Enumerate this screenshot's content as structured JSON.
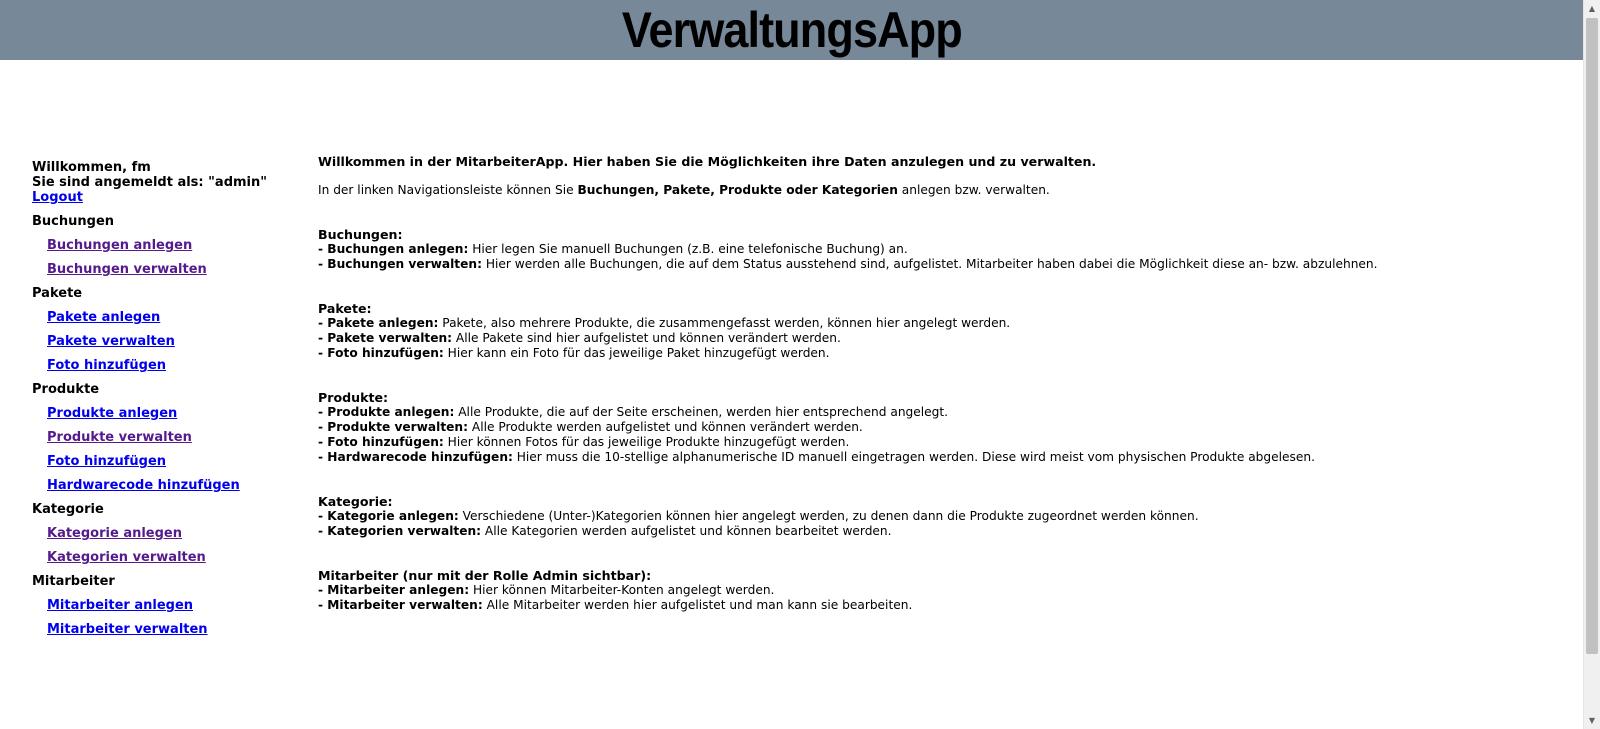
{
  "header": {
    "title": "VerwaltungsApp"
  },
  "user": {
    "welcome": "Willkommen, fm",
    "role_text": "Sie sind angemeldt als: \"admin\"",
    "logout": "Logout"
  },
  "sidebar": {
    "buchungen": {
      "title": "Buchungen",
      "links": [
        "Buchungen anlegen",
        "Buchungen verwalten"
      ]
    },
    "pakete": {
      "title": "Pakete",
      "links": [
        "Pakete anlegen",
        "Pakete verwalten",
        "Foto hinzufügen"
      ]
    },
    "produkte": {
      "title": "Produkte",
      "links": [
        "Produkte anlegen",
        "Produkte verwalten",
        "Foto hinzufügen",
        "Hardwarecode hinzufügen"
      ]
    },
    "kategorie": {
      "title": "Kategorie",
      "links": [
        "Kategorie anlegen",
        "Kategorien verwalten"
      ]
    },
    "mitarbeiter": {
      "title": "Mitarbeiter",
      "links": [
        "Mitarbeiter anlegen",
        "Mitarbeiter verwalten"
      ]
    }
  },
  "main": {
    "intro_title": "Willkommen in der MitarbeiterApp. Hier haben Sie die Möglichkeiten ihre Daten anzulegen und zu verwalten.",
    "intro": {
      "pre": "In der linken Navigationsleiste können Sie ",
      "bold": "Buchungen, Pakete, Produkte oder Kategorien",
      "post": " anlegen bzw. verwalten."
    },
    "blocks": {
      "buchungen": {
        "title": "Buchungen:",
        "items": [
          {
            "label": "- Buchungen anlegen:",
            "text": " Hier legen Sie manuell Buchungen (z.B. eine telefonische Buchung) an."
          },
          {
            "label": "- Buchungen verwalten:",
            "text": " Hier werden alle Buchungen, die auf dem Status ausstehend sind, aufgelistet. Mitarbeiter haben dabei die Möglichkeit diese an- bzw. abzulehnen."
          }
        ]
      },
      "pakete": {
        "title": "Pakete:",
        "items": [
          {
            "label": "- Pakete anlegen:",
            "text": " Pakete, also mehrere Produkte, die zusammengefasst werden, können hier angelegt werden."
          },
          {
            "label": "- Pakete verwalten:",
            "text": " Alle Pakete sind hier aufgelistet und können verändert werden."
          },
          {
            "label": "- Foto hinzufügen:",
            "text": " Hier kann ein Foto für das jeweilige Paket hinzugefügt werden."
          }
        ]
      },
      "produkte": {
        "title": "Produkte:",
        "items": [
          {
            "label": "- Produkte anlegen:",
            "text": " Alle Produkte, die auf der Seite erscheinen, werden hier entsprechend angelegt."
          },
          {
            "label": "- Produkte verwalten:",
            "text": " Alle Produkte werden aufgelistet und können verändert werden."
          },
          {
            "label": "- Foto hinzufügen:",
            "text": " Hier können Fotos für das jeweilige Produkte hinzugefügt werden."
          },
          {
            "label": "- Hardwarecode hinzufügen:",
            "text": " Hier muss die 10-stellige alphanumerische ID manuell eingetragen werden. Diese wird meist vom physischen Produkte abgelesen."
          }
        ]
      },
      "kategorie": {
        "title": "Kategorie:",
        "items": [
          {
            "label": "- Kategorie anlegen:",
            "text": " Verschiedene (Unter-)Kategorien können hier angelegt werden, zu denen dann die Produkte zugeordnet werden können."
          },
          {
            "label": "- Kategorien verwalten:",
            "text": " Alle Kategorien werden aufgelistet und können bearbeitet werden."
          }
        ]
      },
      "mitarbeiter": {
        "title": "Mitarbeiter (nur mit der Rolle Admin sichtbar):",
        "items": [
          {
            "label": "- Mitarbeiter anlegen:",
            "text": " Hier können Mitarbeiter-Konten angelegt werden."
          },
          {
            "label": "- Mitarbeiter verwalten:",
            "text": " Alle Mitarbeiter werden hier aufgelistet und man kann sie bearbeiten."
          }
        ]
      }
    }
  },
  "scrollbar": {
    "up_icon": "arrow-up-icon",
    "down_icon": "arrow-down-icon"
  },
  "colors": {
    "header_bg": "#778899",
    "link": "#0000ee",
    "visited_link": "#551a8b"
  }
}
